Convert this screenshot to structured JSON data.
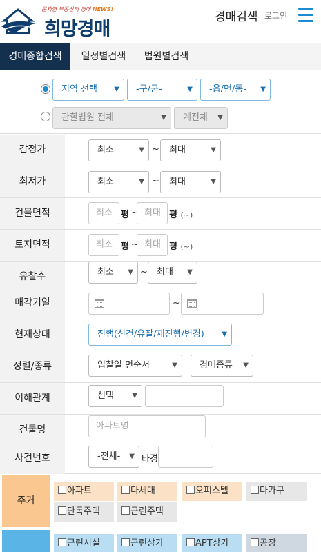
{
  "header": {
    "slogan_prefix": "문체연 부동산의 경매",
    "slogan_news": "NEWS!",
    "brand": "희망경매",
    "title": "경매검색",
    "login": "로그인"
  },
  "tabs": [
    {
      "label": "경매종합검색",
      "active": true
    },
    {
      "label": "일정별검색",
      "active": false
    },
    {
      "label": "법원별검색",
      "active": false
    }
  ],
  "region": {
    "sido": "지역 선택",
    "gugun": "-구/군-",
    "dong": "-읍/면/동-",
    "court": "관할법원 전체",
    "division": "계전체"
  },
  "rows": {
    "appraisal": {
      "label": "감정가",
      "min": "최소",
      "max": "최대",
      "tilde": "~"
    },
    "lowest": {
      "label": "최저가",
      "min": "최소",
      "max": "최대",
      "tilde": "~"
    },
    "building_area": {
      "label": "건물면적",
      "min_ph": "최소",
      "max_ph": "최대",
      "unit": "평",
      "unit_hint": "(~)",
      "tilde": "~"
    },
    "land_area": {
      "label": "토지면적",
      "min_ph": "최소",
      "max_ph": "최대",
      "unit": "평",
      "unit_hint": "(~)",
      "tilde": "~"
    },
    "failed_count": {
      "label": "유찰수",
      "min": "최소",
      "max": "최대",
      "tilde": "~"
    },
    "sale_date": {
      "label": "매각기일",
      "tilde": "~"
    },
    "status": {
      "label": "현재상태",
      "value": "진행(신건/유찰/재진행/변경)"
    },
    "sort": {
      "label": "정렬/종류",
      "order": "입찰일 먼순서",
      "type": "경매종류"
    },
    "interest": {
      "label": "이해관계",
      "value": "선택"
    },
    "building_name": {
      "label": "건물명",
      "placeholder": "아파트명"
    },
    "case_no": {
      "label": "사건번호",
      "court": "-전체-",
      "suffix": "타경"
    }
  },
  "categories": {
    "residential": {
      "label": "주거",
      "items": [
        "아파트",
        "다세대",
        "오피스텔",
        "다가구",
        "단독주택",
        "근린주택"
      ]
    },
    "commercial": {
      "items": [
        "근린시설",
        "근린상가",
        "APT상가",
        "공장"
      ]
    }
  },
  "colors": {
    "accent": "#1a8ccd",
    "tab_active": "#14304f",
    "residential_label": "#f9c78f",
    "residential_chip": "#fbe1c6",
    "other_chip": "#e7e7e7",
    "commercial_label": "#5ab4e6",
    "commercial_chip": "#b9def4"
  }
}
